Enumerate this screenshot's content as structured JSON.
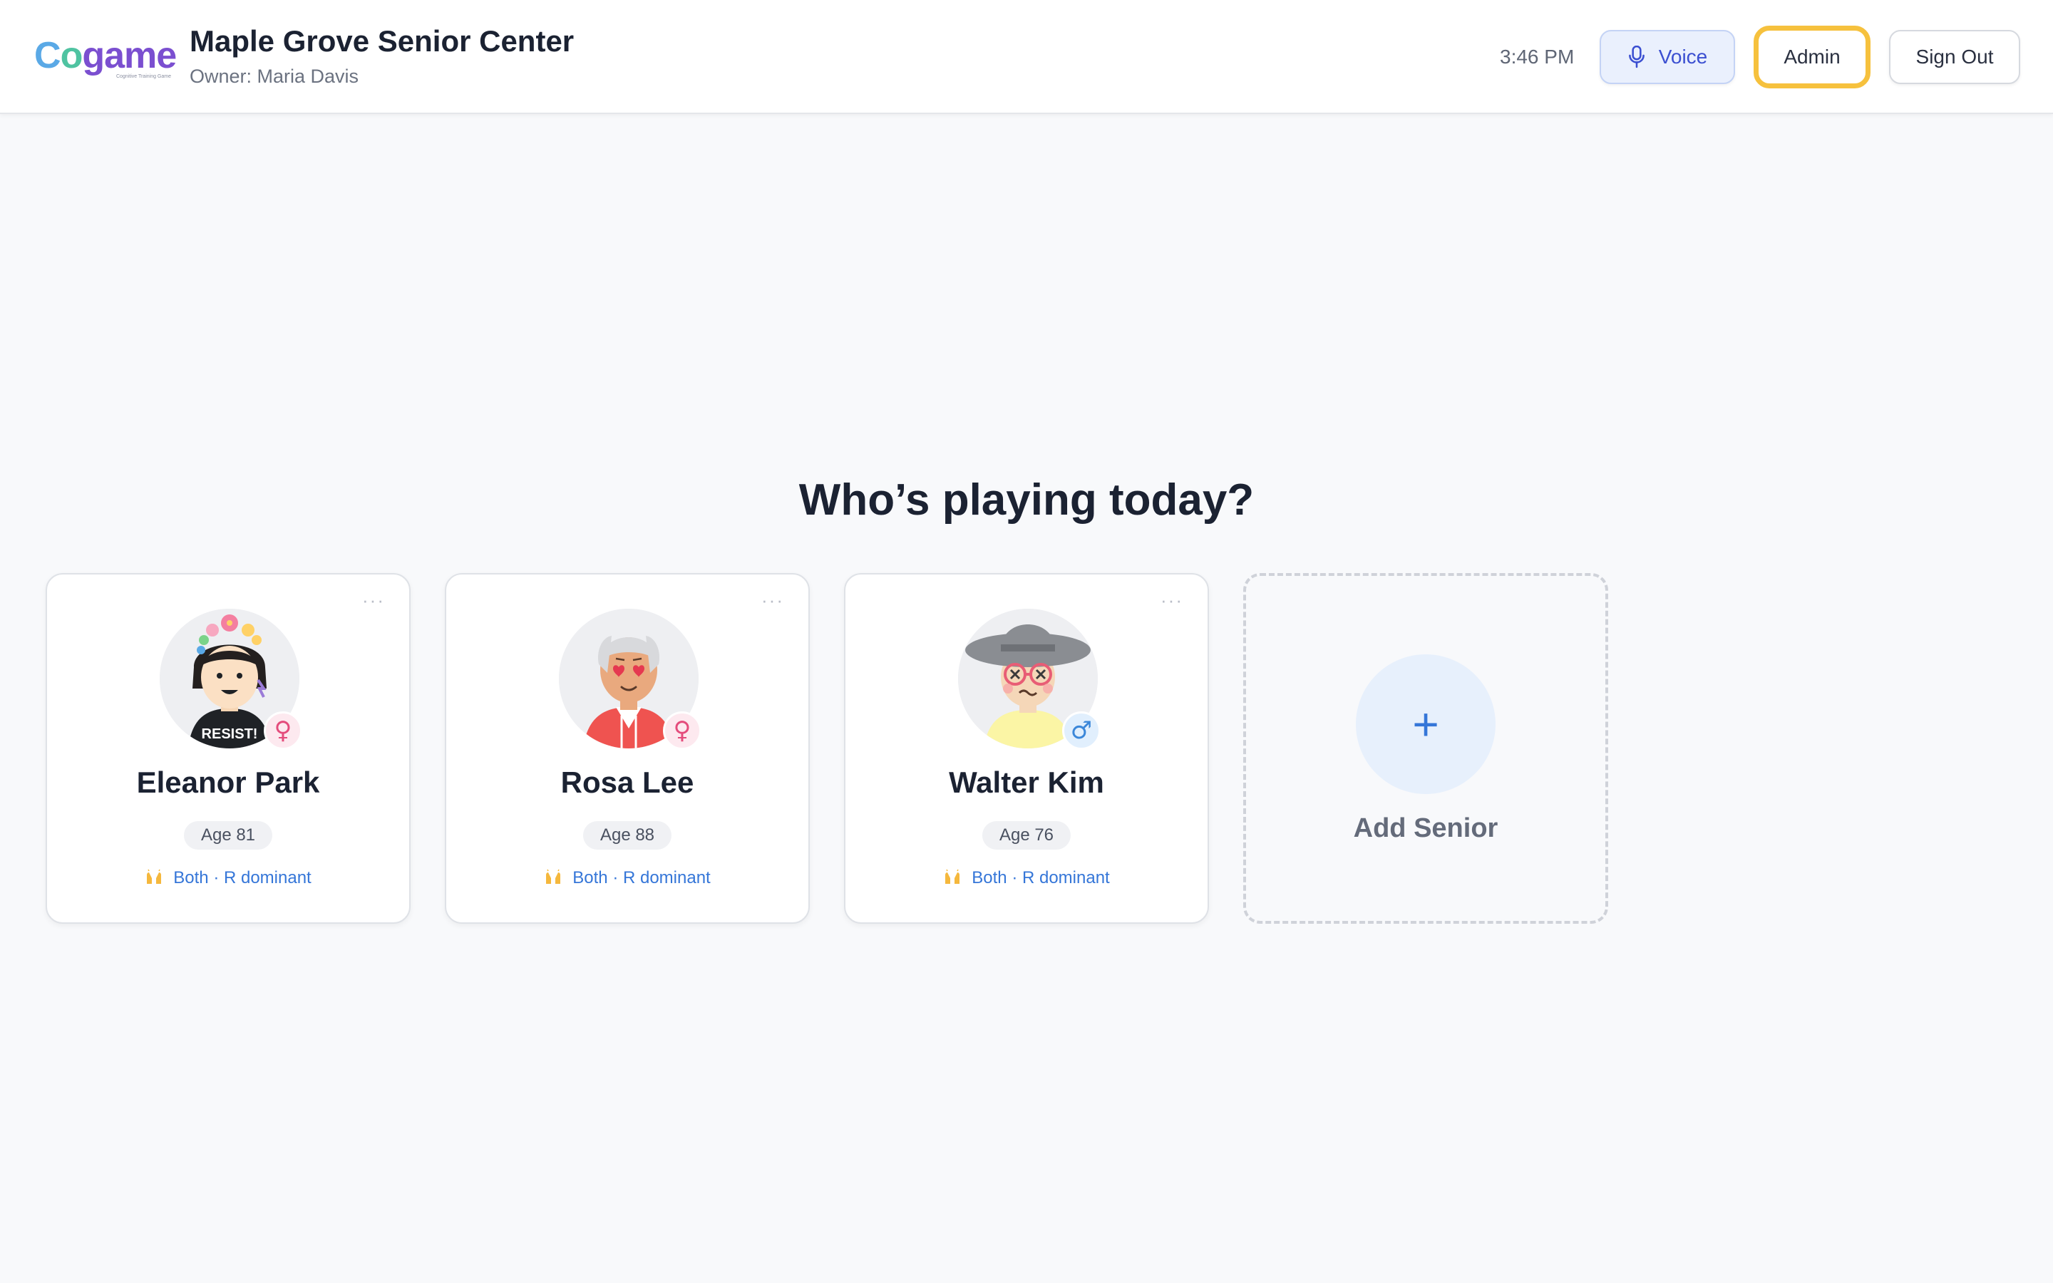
{
  "header": {
    "logo": {
      "text": "Cogame",
      "tagline": "Cognitive Training Game"
    },
    "center_name": "Maple Grove Senior Center",
    "owner": "Owner: Maria Davis",
    "time": "3:46 PM",
    "voice_label": "Voice",
    "admin_label": "Admin",
    "signout_label": "Sign Out"
  },
  "main": {
    "prompt": "Who’s playing today?",
    "seniors": [
      {
        "name": "Eleanor Park",
        "age": "Age 81",
        "gender": "♀",
        "handedness": "Both · R dominant",
        "avatar_shirt_text": "RESIST!",
        "menu": "···"
      },
      {
        "name": "Rosa Lee",
        "age": "Age 88",
        "gender": "♀",
        "handedness": "Both · R dominant",
        "menu": "···"
      },
      {
        "name": "Walter Kim",
        "age": "Age 76",
        "gender": "♂",
        "handedness": "Both · R dominant",
        "menu": "···"
      }
    ],
    "add_card": {
      "plus": "+",
      "label": "Add Senior"
    }
  },
  "colors": {
    "accent_blue": "#3576d8",
    "admin_focus": "#f6c13d",
    "female_badge": "#e44c7c",
    "male_badge": "#3b87d9"
  }
}
